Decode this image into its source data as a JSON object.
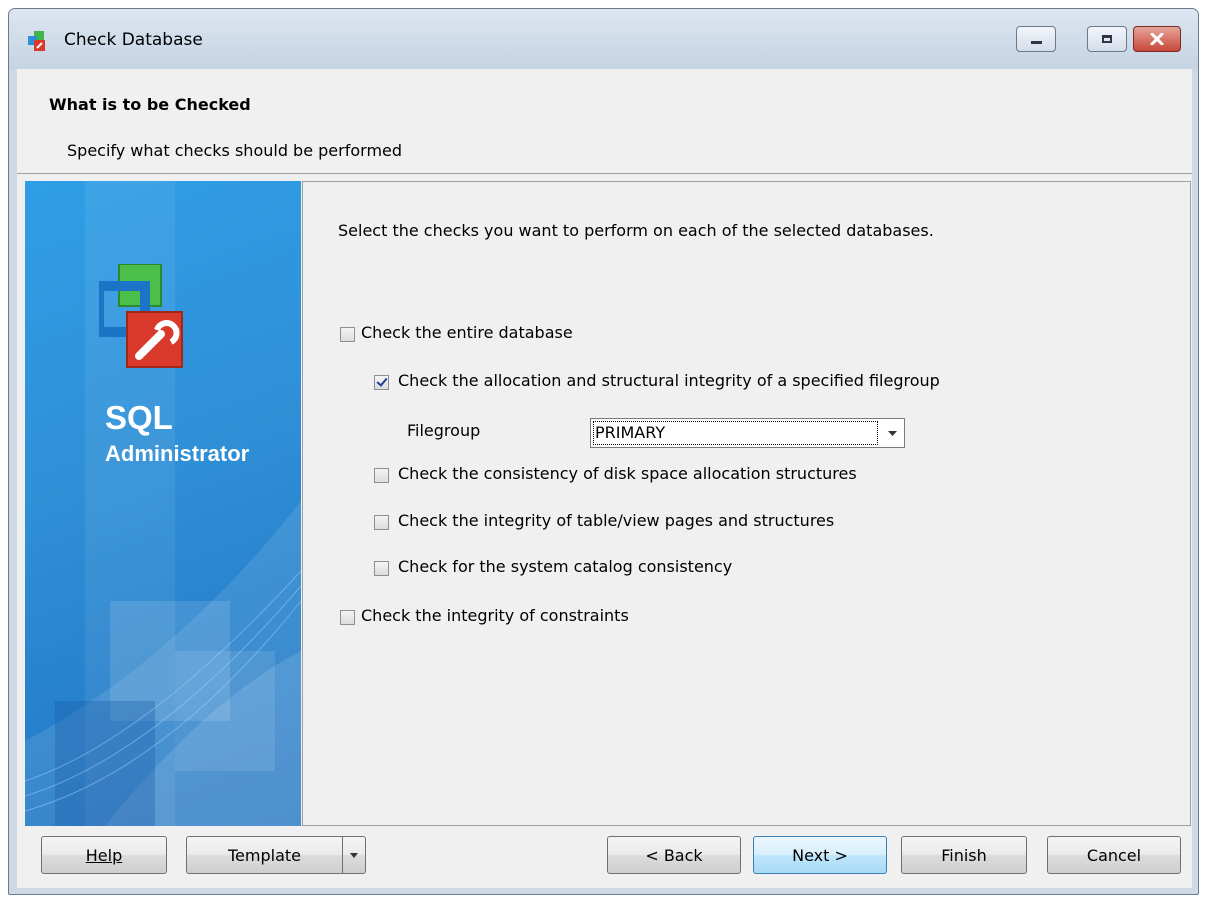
{
  "window": {
    "title": "Check Database"
  },
  "header": {
    "title": "What is to be Checked",
    "subtitle": "Specify what checks should be performed"
  },
  "sidebar": {
    "product_line1": "SQL",
    "product_line2": "Administrator"
  },
  "main": {
    "instruction": "Select the checks you want to perform on each of the selected databases.",
    "options": {
      "entire_db": {
        "label": "Check the entire database",
        "checked": false
      },
      "allocation": {
        "label": "Check the allocation and structural integrity of a specified filegroup",
        "checked": true
      },
      "disk_space": {
        "label": "Check the consistency of disk space allocation structures",
        "checked": false
      },
      "table_view": {
        "label": "Check the integrity of table/view pages and structures",
        "checked": false
      },
      "catalog": {
        "label": "Check for the system catalog consistency",
        "checked": false
      },
      "constraints": {
        "label": "Check the integrity of constraints",
        "checked": false
      }
    },
    "filegroup": {
      "label": "Filegroup",
      "value": "PRIMARY"
    }
  },
  "footer": {
    "help": "Help",
    "template": "Template",
    "back": "< Back",
    "next": "Next >",
    "finish": "Finish",
    "cancel": "Cancel"
  }
}
